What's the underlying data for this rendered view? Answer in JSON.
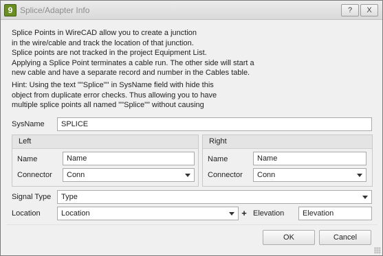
{
  "window": {
    "title": "Splice/Adapter Info",
    "app_icon_glyph": "9",
    "help_label": "?",
    "close_label": "X"
  },
  "intro_lines": [
    "Splice Points in WireCAD allow you to create a junction",
    "in the wire/cable and track the location of that junction.",
    "Splice points are not tracked in the project Equipment List.",
    "Applying a Splice Point terminates a cable run. The other side will start a",
    "new cable and have a separate record and number in the Cables table."
  ],
  "hint_lines": [
    "Hint: Using the text \"\"Splice\"\" in SysName field with hide this",
    "object from duplicate error checks. Thus allowing you to have",
    "multiple splice points all named \"\"Splice\"\" without causing"
  ],
  "sysname": {
    "label": "SysName",
    "value": "SPLICE"
  },
  "left_group": {
    "title": "Left",
    "name_label": "Name",
    "name_value": "Name",
    "connector_label": "Connector",
    "connector_value": "Conn"
  },
  "right_group": {
    "title": "Right",
    "name_label": "Name",
    "name_value": "Name",
    "connector_label": "Connector",
    "connector_value": "Conn"
  },
  "signal_type": {
    "label": "Signal Type",
    "value": "Type"
  },
  "location": {
    "label": "Location",
    "value": "Location",
    "add_glyph": "+"
  },
  "elevation": {
    "label": "Elevation",
    "value": "Elevation"
  },
  "buttons": {
    "ok": "OK",
    "cancel": "Cancel"
  },
  "icons": {
    "app": "app-icon",
    "help": "help-icon",
    "close": "close-icon",
    "combo": "chevron-down-icon",
    "add": "plus-icon"
  }
}
